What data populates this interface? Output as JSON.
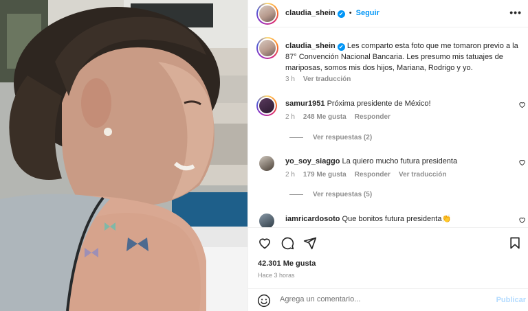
{
  "post": {
    "username": "claudia_shein",
    "verified_icon": "✔",
    "dot": "•",
    "follow_label": "Seguir",
    "more_icon": "•••"
  },
  "caption": {
    "username": "claudia_shein",
    "text": "Les comparto esta foto que me tomaron previo a la 87° Convención Nacional Bancaria. Les presumo mis tatuajes de mariposas, somos mis dos hijos, Mariana, Rodrigo y yo.",
    "time": "3 h",
    "translate_label": "Ver traducción"
  },
  "comments": [
    {
      "username": "samur1951",
      "text": "Próxima presidente de México!",
      "time": "2 h",
      "likes": "248 Me gusta",
      "reply_label": "Responder",
      "translate_label": "",
      "view_replies": "Ver respuestas (2)"
    },
    {
      "username": "yo_soy_siaggo",
      "text": "La quiero mucho futura presidenta",
      "time": "2 h",
      "likes": "179 Me gusta",
      "reply_label": "Responder",
      "translate_label": "Ver traducción",
      "view_replies": "Ver respuestas (5)"
    },
    {
      "username": "iamricardosoto",
      "text": "Que bonitos futura presidenta👏"
    }
  ],
  "footer": {
    "likes": "42.301 Me gusta",
    "time_ago": "Hace 3 horas",
    "add_comment_placeholder": "Agrega un comentario...",
    "publish_label": "Publicar"
  },
  "colors": {
    "accent": "#0095f6",
    "publish_disabled": "#b3dbff",
    "muted": "#8e8e8e"
  }
}
